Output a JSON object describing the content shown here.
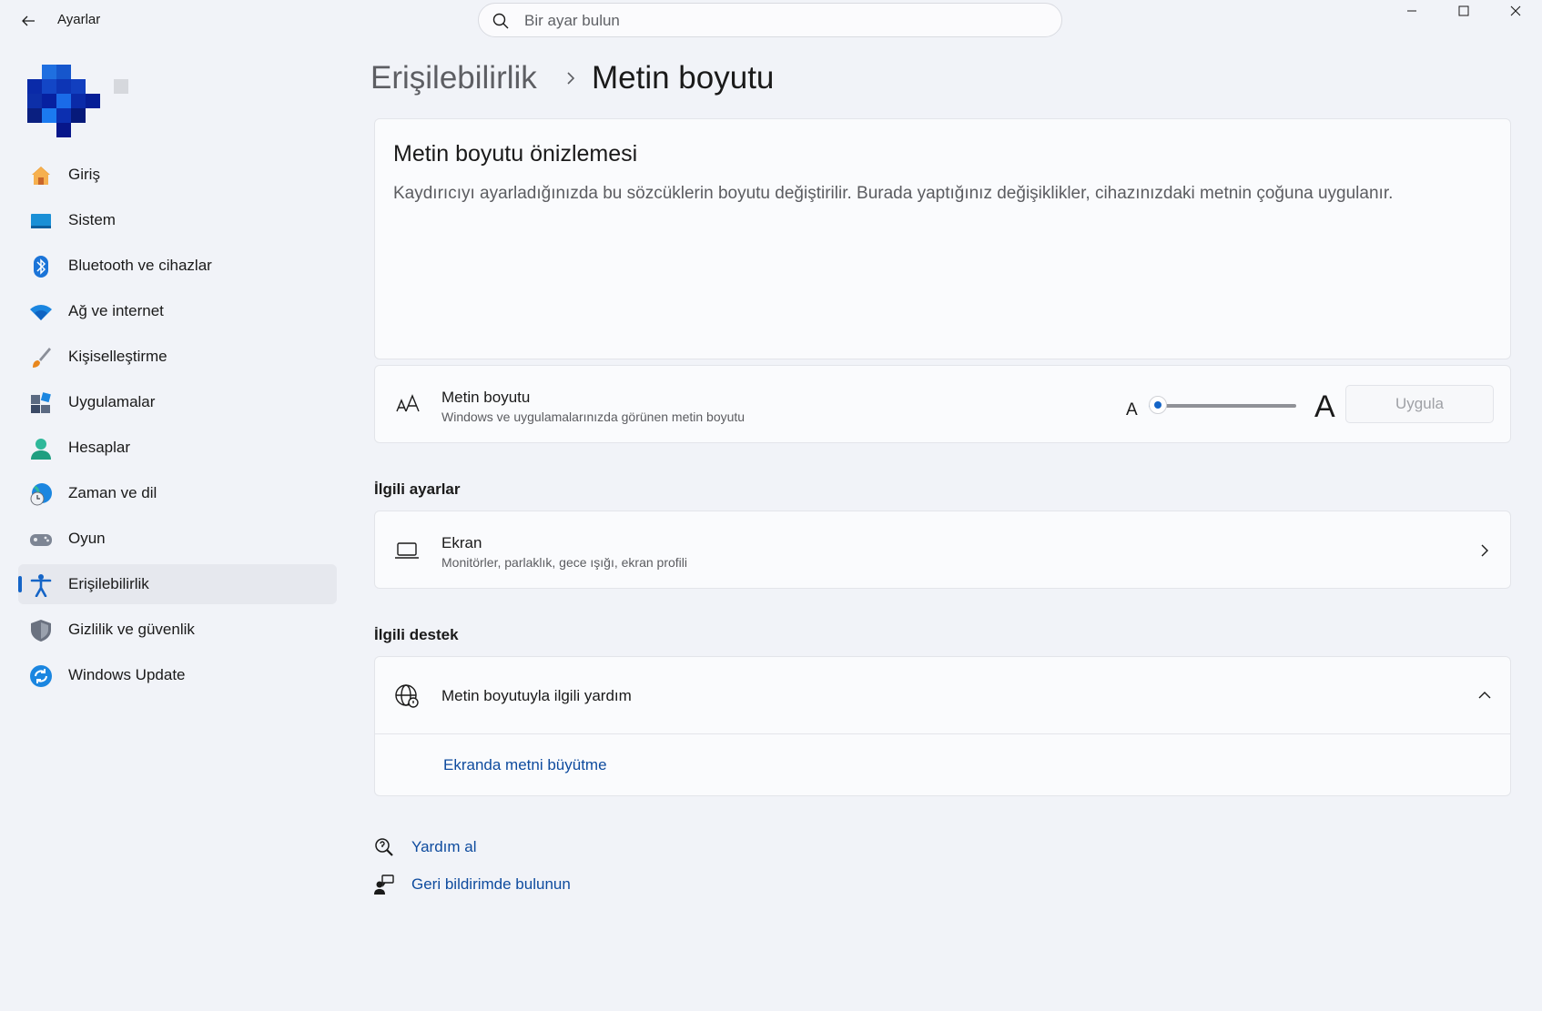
{
  "window": {
    "title": "Ayarlar",
    "search_placeholder": "Bir ayar bulun"
  },
  "sidebar": {
    "items": [
      {
        "label": "Giriş",
        "icon": "home-icon"
      },
      {
        "label": "Sistem",
        "icon": "system-display-icon"
      },
      {
        "label": "Bluetooth ve cihazlar",
        "icon": "bluetooth-icon"
      },
      {
        "label": "Ağ ve internet",
        "icon": "wifi-icon"
      },
      {
        "label": "Kişiselleştirme",
        "icon": "paintbrush-icon"
      },
      {
        "label": "Uygulamalar",
        "icon": "apps-icon"
      },
      {
        "label": "Hesaplar",
        "icon": "account-icon"
      },
      {
        "label": "Zaman ve dil",
        "icon": "globe-clock-icon"
      },
      {
        "label": "Oyun",
        "icon": "gamepad-icon"
      },
      {
        "label": "Erişilebilirlik",
        "icon": "accessibility-icon",
        "active": true
      },
      {
        "label": "Gizlilik ve güvenlik",
        "icon": "shield-icon"
      },
      {
        "label": "Windows Update",
        "icon": "update-icon"
      }
    ]
  },
  "breadcrumb": {
    "parent": "Erişilebilirlik",
    "current": "Metin boyutu"
  },
  "preview": {
    "title": "Metin boyutu önizlemesi",
    "text": "Kaydırıcıyı ayarladığınızda bu sözcüklerin boyutu değiştirilir. Burada yaptığınız değişiklikler, cihazınızdaki metnin çoğuna uygulanır."
  },
  "text_size": {
    "title": "Metin boyutu",
    "subtitle": "Windows ve uygulamalarınızda görünen metin boyutu",
    "small_label": "A",
    "large_label": "A",
    "slider_value_fraction": 0.0,
    "apply_label": "Uygula"
  },
  "related_settings": {
    "heading": "İlgili ayarlar",
    "ekran_title": "Ekran",
    "ekran_subtitle": "Monitörler, parlaklık, gece ışığı, ekran profili"
  },
  "related_support": {
    "heading": "İlgili destek",
    "help_title": "Metin boyutuyla ilgili yardım",
    "link": "Ekranda metni büyütme"
  },
  "footer": {
    "get_help": "Yardım al",
    "feedback": "Geri bildirimde bulunun"
  },
  "colors": {
    "accent": "#1565c7",
    "link": "#0e4b9e",
    "background": "#f1f3f8",
    "card": "#fafbfd"
  }
}
